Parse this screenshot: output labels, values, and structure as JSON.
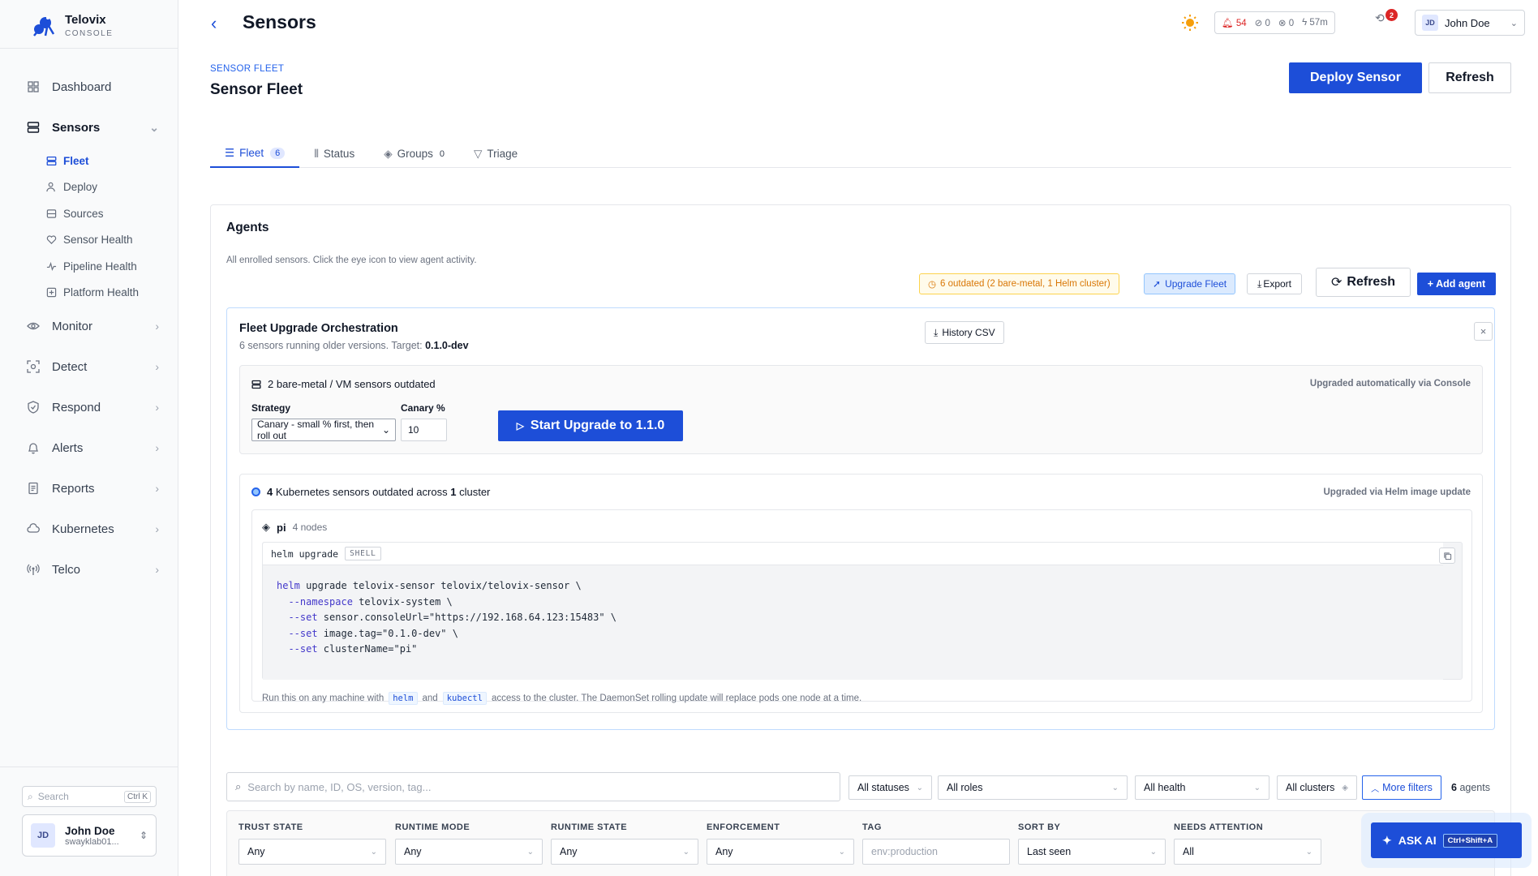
{
  "brand": {
    "name": "Telovix",
    "sub": "CONSOLE"
  },
  "nav": {
    "items": [
      {
        "label": "Dashboard"
      },
      {
        "label": "Sensors"
      },
      {
        "label": "Monitor"
      },
      {
        "label": "Detect"
      },
      {
        "label": "Respond"
      },
      {
        "label": "Alerts"
      },
      {
        "label": "Reports"
      },
      {
        "label": "Kubernetes"
      },
      {
        "label": "Telco"
      }
    ],
    "sensors_sub": [
      {
        "label": "Fleet"
      },
      {
        "label": "Deploy"
      },
      {
        "label": "Sources"
      },
      {
        "label": "Sensor Health"
      },
      {
        "label": "Pipeline Health"
      },
      {
        "label": "Platform Health"
      }
    ]
  },
  "sidebar_search": {
    "placeholder": "Search",
    "shortcut": "Ctrl K"
  },
  "sidebar_user": {
    "initials": "JD",
    "name": "John Doe",
    "email": "swayklab01..."
  },
  "header": {
    "title": "Sensors",
    "stats": {
      "alerts": "54",
      "muted": "0",
      "blocked": "0",
      "uptime": "57m"
    },
    "notif_count": "2",
    "user": {
      "initials": "JD",
      "name": "John Doe"
    }
  },
  "page": {
    "eyebrow": "SENSOR FLEET",
    "title": "Sensor Fleet",
    "deploy_label": "Deploy Sensor",
    "refresh_label": "Refresh"
  },
  "tabs": [
    {
      "label": "Fleet",
      "count": "6"
    },
    {
      "label": "Status",
      "count": ""
    },
    {
      "label": "Groups",
      "count": "0"
    },
    {
      "label": "Triage",
      "count": ""
    }
  ],
  "agents": {
    "title": "Agents",
    "subtitle": "All enrolled sensors. Click the eye icon to view agent activity.",
    "outdated_pill": "6 outdated (2 bare-metal, 1 Helm cluster)",
    "upgrade_fleet": "Upgrade Fleet",
    "export": "Export",
    "refresh": "Refresh",
    "add_agent": "+ Add agent"
  },
  "orchestration": {
    "title": "Fleet Upgrade Orchestration",
    "subtitle_prefix": "6 sensors running older versions. Target:",
    "target": "0.1.0-dev",
    "history_csv": "History CSV",
    "baremetal": {
      "heading": "2 bare-metal / VM sensors outdated",
      "note": "Upgraded automatically via Console",
      "strategy_label": "Strategy",
      "strategy_value": "Canary - small % first, then roll out",
      "canary_label": "Canary %",
      "canary_value": "10",
      "start_label": "Start Upgrade to 1.1.0"
    },
    "k8s": {
      "count": "4",
      "heading_mid": "Kubernetes sensors outdated across",
      "cluster_count": "1",
      "heading_end": "cluster",
      "note": "Upgraded via Helm image update",
      "cluster_name": "pi",
      "cluster_nodes": "4 nodes",
      "code_title": "helm upgrade",
      "code_lang": "SHELL",
      "code_lines": [
        {
          "kw": "helm",
          "rest": " upgrade telovix-sensor telovix/telovix-sensor \\"
        },
        {
          "kw": "  --namespace",
          "rest": " telovix-system \\"
        },
        {
          "kw": "  --set",
          "rest": " sensor.consoleUrl=\"https://192.168.64.123:15483\" \\"
        },
        {
          "kw": "  --set",
          "rest": " image.tag=\"0.1.0-dev\" \\"
        },
        {
          "kw": "  --set",
          "rest": " clusterName=\"pi\""
        }
      ],
      "foot_1": "Run this on any machine with",
      "foot_chip1": "helm",
      "foot_2": "and",
      "foot_chip2": "kubectl",
      "foot_3": "access to the cluster. The DaemonSet rolling update will replace pods one node at a time."
    }
  },
  "filters": {
    "search_placeholder": "Search by name, ID, OS, version, tag...",
    "status": "All statuses",
    "roles": "All roles",
    "health": "All health",
    "clusters": "All clusters",
    "more": "More filters",
    "agent_count": "6",
    "agent_count_suffix": "agents"
  },
  "advanced": {
    "trust_label": "TRUST STATE",
    "trust_value": "Any",
    "mode_label": "RUNTIME MODE",
    "mode_value": "Any",
    "state_label": "RUNTIME STATE",
    "state_value": "Any",
    "enf_label": "ENFORCEMENT",
    "enf_value": "Any",
    "tag_label": "TAG",
    "tag_placeholder": "env:production",
    "sort_label": "SORT BY",
    "sort_value": "Last seen",
    "attn_label": "NEEDS ATTENTION",
    "attn_value": "All"
  },
  "askai": {
    "label": "ASK AI",
    "shortcut": "Ctrl+Shift+A"
  },
  "colors": {
    "accent": "#1d4ed8",
    "warn": "#d97706",
    "danger": "#dc2626"
  }
}
